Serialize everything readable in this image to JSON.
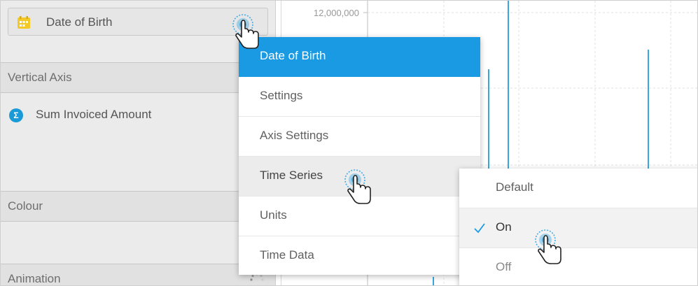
{
  "field_pill": {
    "label": "Date of Birth",
    "icon": "calendar-icon",
    "icon_color": "#f3c928"
  },
  "sections": {
    "vertical_axis": "Vertical Axis",
    "colour": "Colour",
    "animation": "Animation"
  },
  "measure": {
    "icon": "sigma-icon",
    "label": "Sum Invoiced Amount",
    "icon_color": "#1a9ad6"
  },
  "chart": {
    "visible_tick": "12,000,000",
    "bar_color": "#3aa6e0"
  },
  "context_menu": {
    "items": [
      {
        "label": "Date of Birth",
        "state": "active"
      },
      {
        "label": "Settings"
      },
      {
        "label": "Axis Settings"
      },
      {
        "label": "Time Series",
        "state": "hover"
      },
      {
        "label": "Units"
      },
      {
        "label": "Time Data"
      }
    ],
    "active_color": "#1a9ae3"
  },
  "time_series_submenu": {
    "items": [
      {
        "label": "Default"
      },
      {
        "label": "On",
        "checked": true
      },
      {
        "label": "Off"
      }
    ]
  }
}
